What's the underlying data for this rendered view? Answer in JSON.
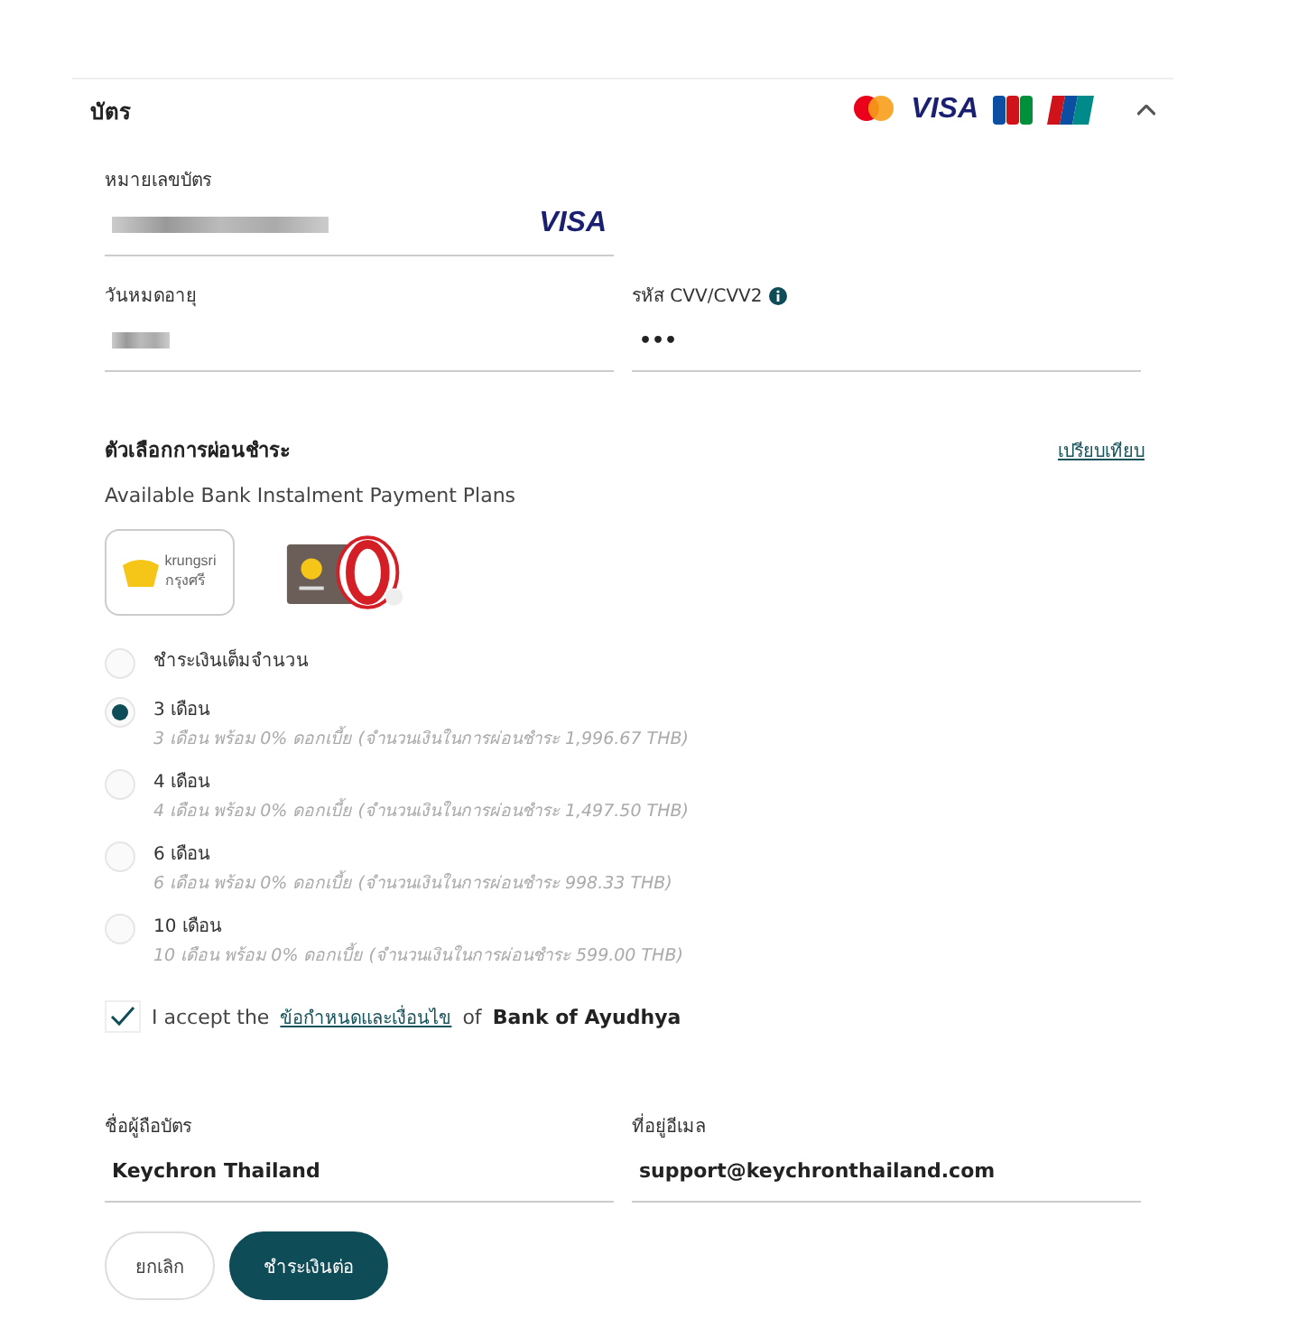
{
  "section": {
    "title": "บัตร",
    "expanded": true,
    "brands": [
      {
        "kind": "mastercard"
      },
      {
        "kind": "visa",
        "label": "VISA"
      },
      {
        "kind": "jcb"
      },
      {
        "kind": "unionpay"
      }
    ]
  },
  "card_number": {
    "label": "หมายเลขบัตร",
    "brand": "VISA"
  },
  "expiry": {
    "label": "วันหมดอายุ"
  },
  "cvv": {
    "label": "รหัส CVV/CVV2",
    "value": "•••"
  },
  "installments": {
    "title": "ตัวเลือกการผ่อนชำระ",
    "compare_link": "เปรียบเทียบ",
    "subtitle": "Available Bank Instalment Payment Plans",
    "banks": [
      {
        "kind": "krungsri",
        "name": "krungsri",
        "name_th": "กรุงศรี",
        "selected": true
      },
      {
        "kind": "krungsri-zero",
        "selected": false
      }
    ],
    "options": [
      {
        "label": "ชำระเงินเต็มจำนวน",
        "selected": false
      },
      {
        "label": "3 เดือน",
        "detail": "3 เดือน พร้อม 0% ดอกเบี้ย (จำนวนเงินในการผ่อนชำระ 1,996.67 THB)",
        "selected": true
      },
      {
        "label": "4 เดือน",
        "detail": "4 เดือน พร้อม 0% ดอกเบี้ย (จำนวนเงินในการผ่อนชำระ 1,497.50 THB)",
        "selected": false
      },
      {
        "label": "6 เดือน",
        "detail": "6 เดือน พร้อม 0% ดอกเบี้ย (จำนวนเงินในการผ่อนชำระ 998.33 THB)",
        "selected": false
      },
      {
        "label": "10 เดือน",
        "detail": "10 เดือน พร้อม 0% ดอกเบี้ย (จำนวนเงินในการผ่อนชำระ 599.00 THB)",
        "selected": false
      }
    ]
  },
  "terms": {
    "checked": true,
    "before": "I accept the",
    "link": "ข้อกำหนดและเงื่อนไข",
    "middle": "of",
    "bank": "Bank of Ayudhya"
  },
  "holder": {
    "label": "ชื่อผู้ถือบัตร",
    "value": "Keychron Thailand"
  },
  "email": {
    "label": "ที่อยู่อีเมล",
    "value": "support@keychronthailand.com"
  },
  "buttons": [
    {
      "kind": "secondary",
      "label": "ยกเลิก"
    },
    {
      "kind": "primary",
      "label": "ชำระเงินต่อ"
    }
  ]
}
